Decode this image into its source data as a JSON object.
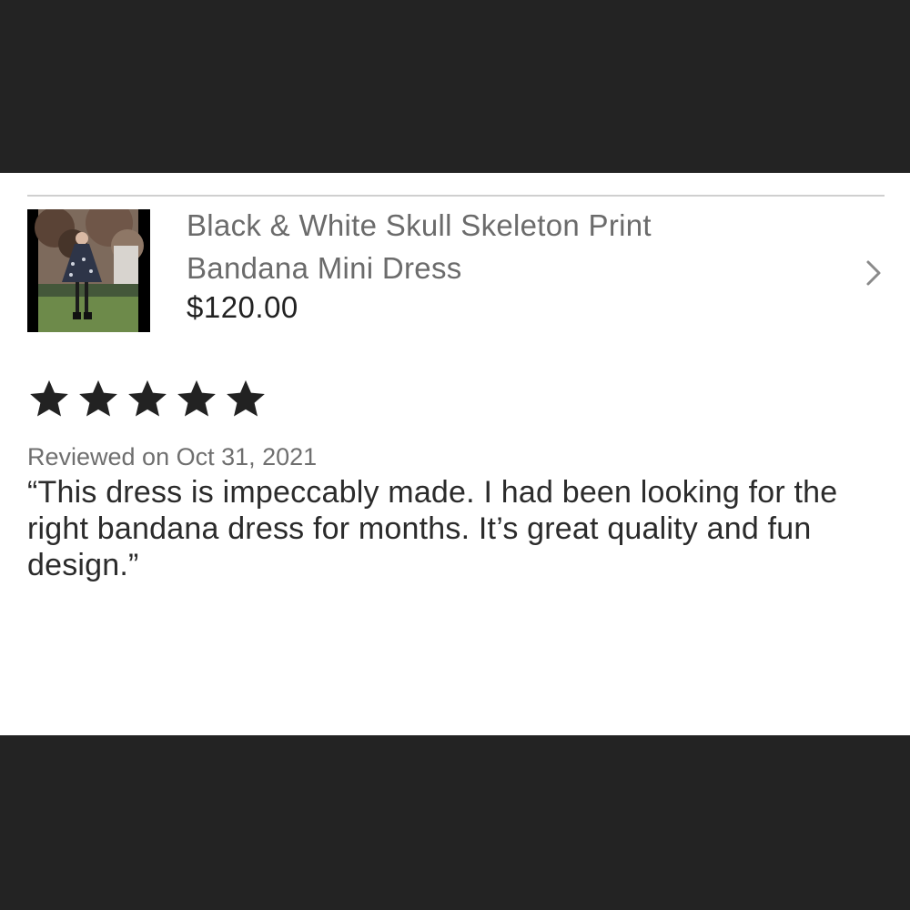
{
  "listing": {
    "title_line1": "Black & White Skull Skeleton Print",
    "title_line2": "Bandana Mini Dress",
    "price": "$120.00",
    "thumbnail": "product-photo-dress-garden"
  },
  "review": {
    "rating": 5,
    "rating_max": 5,
    "date_label": "Reviewed on Oct 31, 2021",
    "text": "“This dress is impeccably made. I had been looking for the right bandana dress for months. It’s great quality and fun design.”"
  },
  "icons": {
    "chevron": "chevron-right-icon",
    "star": "star-icon"
  },
  "colors": {
    "background": "#232323",
    "card": "#ffffff",
    "star": "#222222",
    "muted_text": "#6b6b6b"
  }
}
